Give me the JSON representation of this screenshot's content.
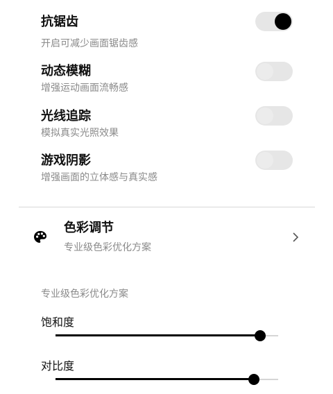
{
  "settings": [
    {
      "title": "抗锯齿",
      "subtitle": "开启可减少画面锯齿感",
      "enabled": true
    },
    {
      "title": "动态模糊",
      "subtitle": "增强运动画面流畅感",
      "enabled": false
    },
    {
      "title": "光线追踪",
      "subtitle": "模拟真实光照效果",
      "enabled": false
    },
    {
      "title": "游戏阴影",
      "subtitle": "增强画面的立体感与真实感",
      "enabled": false
    }
  ],
  "color_adjust": {
    "title": "色彩调节",
    "subtitle": "专业级色彩优化方案",
    "icon": "palette-icon"
  },
  "section_label": "专业级色彩优化方案",
  "sliders": [
    {
      "label": "饱和度",
      "value_fraction": 0.92
    },
    {
      "label": "对比度",
      "value_fraction": 0.89
    }
  ],
  "colors": {
    "accent": "#000000",
    "track": "#d5d5d5",
    "toggle_off": "#e6e6e6"
  }
}
